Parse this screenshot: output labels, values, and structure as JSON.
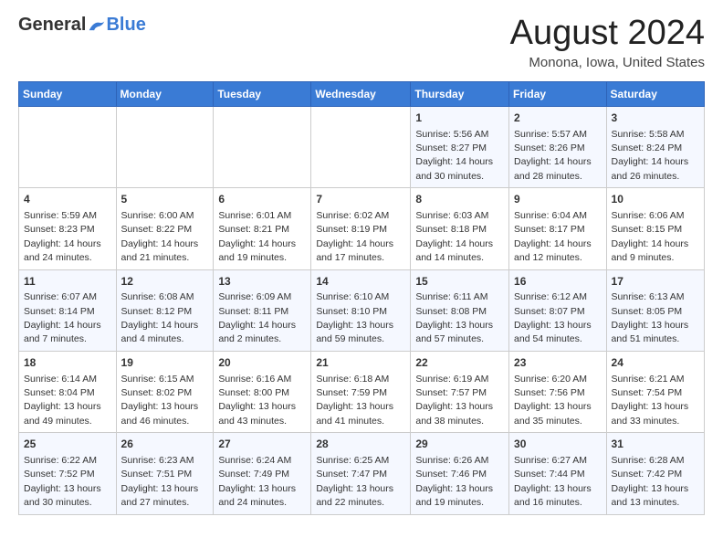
{
  "logo": {
    "general": "General",
    "blue": "Blue"
  },
  "header": {
    "title": "August 2024",
    "subtitle": "Monona, Iowa, United States"
  },
  "days_of_week": [
    "Sunday",
    "Monday",
    "Tuesday",
    "Wednesday",
    "Thursday",
    "Friday",
    "Saturday"
  ],
  "weeks": [
    [
      {
        "day": "",
        "info": ""
      },
      {
        "day": "",
        "info": ""
      },
      {
        "day": "",
        "info": ""
      },
      {
        "day": "",
        "info": ""
      },
      {
        "day": "1",
        "info": "Sunrise: 5:56 AM\nSunset: 8:27 PM\nDaylight: 14 hours and 30 minutes."
      },
      {
        "day": "2",
        "info": "Sunrise: 5:57 AM\nSunset: 8:26 PM\nDaylight: 14 hours and 28 minutes."
      },
      {
        "day": "3",
        "info": "Sunrise: 5:58 AM\nSunset: 8:24 PM\nDaylight: 14 hours and 26 minutes."
      }
    ],
    [
      {
        "day": "4",
        "info": "Sunrise: 5:59 AM\nSunset: 8:23 PM\nDaylight: 14 hours and 24 minutes."
      },
      {
        "day": "5",
        "info": "Sunrise: 6:00 AM\nSunset: 8:22 PM\nDaylight: 14 hours and 21 minutes."
      },
      {
        "day": "6",
        "info": "Sunrise: 6:01 AM\nSunset: 8:21 PM\nDaylight: 14 hours and 19 minutes."
      },
      {
        "day": "7",
        "info": "Sunrise: 6:02 AM\nSunset: 8:19 PM\nDaylight: 14 hours and 17 minutes."
      },
      {
        "day": "8",
        "info": "Sunrise: 6:03 AM\nSunset: 8:18 PM\nDaylight: 14 hours and 14 minutes."
      },
      {
        "day": "9",
        "info": "Sunrise: 6:04 AM\nSunset: 8:17 PM\nDaylight: 14 hours and 12 minutes."
      },
      {
        "day": "10",
        "info": "Sunrise: 6:06 AM\nSunset: 8:15 PM\nDaylight: 14 hours and 9 minutes."
      }
    ],
    [
      {
        "day": "11",
        "info": "Sunrise: 6:07 AM\nSunset: 8:14 PM\nDaylight: 14 hours and 7 minutes."
      },
      {
        "day": "12",
        "info": "Sunrise: 6:08 AM\nSunset: 8:12 PM\nDaylight: 14 hours and 4 minutes."
      },
      {
        "day": "13",
        "info": "Sunrise: 6:09 AM\nSunset: 8:11 PM\nDaylight: 14 hours and 2 minutes."
      },
      {
        "day": "14",
        "info": "Sunrise: 6:10 AM\nSunset: 8:10 PM\nDaylight: 13 hours and 59 minutes."
      },
      {
        "day": "15",
        "info": "Sunrise: 6:11 AM\nSunset: 8:08 PM\nDaylight: 13 hours and 57 minutes."
      },
      {
        "day": "16",
        "info": "Sunrise: 6:12 AM\nSunset: 8:07 PM\nDaylight: 13 hours and 54 minutes."
      },
      {
        "day": "17",
        "info": "Sunrise: 6:13 AM\nSunset: 8:05 PM\nDaylight: 13 hours and 51 minutes."
      }
    ],
    [
      {
        "day": "18",
        "info": "Sunrise: 6:14 AM\nSunset: 8:04 PM\nDaylight: 13 hours and 49 minutes."
      },
      {
        "day": "19",
        "info": "Sunrise: 6:15 AM\nSunset: 8:02 PM\nDaylight: 13 hours and 46 minutes."
      },
      {
        "day": "20",
        "info": "Sunrise: 6:16 AM\nSunset: 8:00 PM\nDaylight: 13 hours and 43 minutes."
      },
      {
        "day": "21",
        "info": "Sunrise: 6:18 AM\nSunset: 7:59 PM\nDaylight: 13 hours and 41 minutes."
      },
      {
        "day": "22",
        "info": "Sunrise: 6:19 AM\nSunset: 7:57 PM\nDaylight: 13 hours and 38 minutes."
      },
      {
        "day": "23",
        "info": "Sunrise: 6:20 AM\nSunset: 7:56 PM\nDaylight: 13 hours and 35 minutes."
      },
      {
        "day": "24",
        "info": "Sunrise: 6:21 AM\nSunset: 7:54 PM\nDaylight: 13 hours and 33 minutes."
      }
    ],
    [
      {
        "day": "25",
        "info": "Sunrise: 6:22 AM\nSunset: 7:52 PM\nDaylight: 13 hours and 30 minutes."
      },
      {
        "day": "26",
        "info": "Sunrise: 6:23 AM\nSunset: 7:51 PM\nDaylight: 13 hours and 27 minutes."
      },
      {
        "day": "27",
        "info": "Sunrise: 6:24 AM\nSunset: 7:49 PM\nDaylight: 13 hours and 24 minutes."
      },
      {
        "day": "28",
        "info": "Sunrise: 6:25 AM\nSunset: 7:47 PM\nDaylight: 13 hours and 22 minutes."
      },
      {
        "day": "29",
        "info": "Sunrise: 6:26 AM\nSunset: 7:46 PM\nDaylight: 13 hours and 19 minutes."
      },
      {
        "day": "30",
        "info": "Sunrise: 6:27 AM\nSunset: 7:44 PM\nDaylight: 13 hours and 16 minutes."
      },
      {
        "day": "31",
        "info": "Sunrise: 6:28 AM\nSunset: 7:42 PM\nDaylight: 13 hours and 13 minutes."
      }
    ]
  ]
}
